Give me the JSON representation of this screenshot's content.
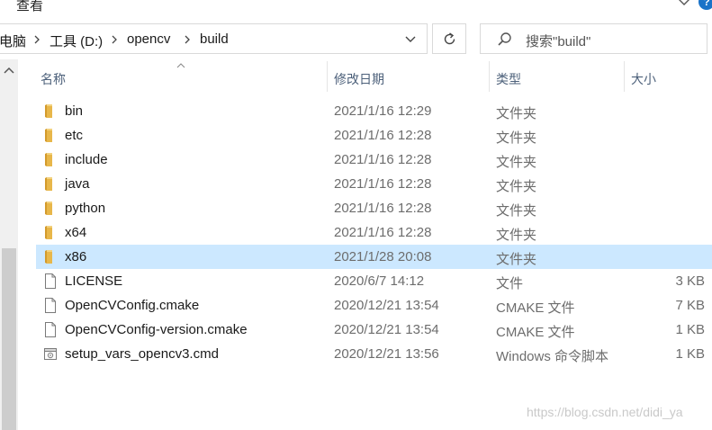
{
  "header": {
    "menu_label": "查看"
  },
  "address": {
    "crumbs": [
      "电脑",
      "工具 (D:)",
      "opencv",
      "build"
    ]
  },
  "search": {
    "placeholder": "搜索\"build\""
  },
  "columns": {
    "name": "名称",
    "date": "修改日期",
    "type": "类型",
    "size": "大小"
  },
  "files": [
    {
      "name": "bin",
      "date": "2021/1/16 12:29",
      "type": "文件夹",
      "size": "",
      "icon": "folder-icon",
      "selected": false
    },
    {
      "name": "etc",
      "date": "2021/1/16 12:28",
      "type": "文件夹",
      "size": "",
      "icon": "folder-icon",
      "selected": false
    },
    {
      "name": "include",
      "date": "2021/1/16 12:28",
      "type": "文件夹",
      "size": "",
      "icon": "folder-icon",
      "selected": false
    },
    {
      "name": "java",
      "date": "2021/1/16 12:28",
      "type": "文件夹",
      "size": "",
      "icon": "folder-icon",
      "selected": false
    },
    {
      "name": "python",
      "date": "2021/1/16 12:28",
      "type": "文件夹",
      "size": "",
      "icon": "folder-icon",
      "selected": false
    },
    {
      "name": "x64",
      "date": "2021/1/16 12:28",
      "type": "文件夹",
      "size": "",
      "icon": "folder-icon",
      "selected": false
    },
    {
      "name": "x86",
      "date": "2021/1/28 20:08",
      "type": "文件夹",
      "size": "",
      "icon": "folder-icon",
      "selected": true
    },
    {
      "name": "LICENSE",
      "date": "2020/6/7 14:12",
      "type": "文件",
      "size": "3 KB",
      "icon": "file-icon",
      "selected": false
    },
    {
      "name": "OpenCVConfig.cmake",
      "date": "2020/12/21 13:54",
      "type": "CMAKE 文件",
      "size": "7 KB",
      "icon": "file-icon",
      "selected": false
    },
    {
      "name": "OpenCVConfig-version.cmake",
      "date": "2020/12/21 13:54",
      "type": "CMAKE 文件",
      "size": "1 KB",
      "icon": "file-icon",
      "selected": false
    },
    {
      "name": "setup_vars_opencv3.cmd",
      "date": "2020/12/21 13:56",
      "type": "Windows 命令脚本",
      "size": "1 KB",
      "icon": "script-icon",
      "selected": false
    }
  ],
  "watermark": "https://blog.csdn.net/didi_ya",
  "colors": {
    "selection": "#cce8ff",
    "folder": "#e8b74a",
    "header_text": "#4c607a"
  }
}
